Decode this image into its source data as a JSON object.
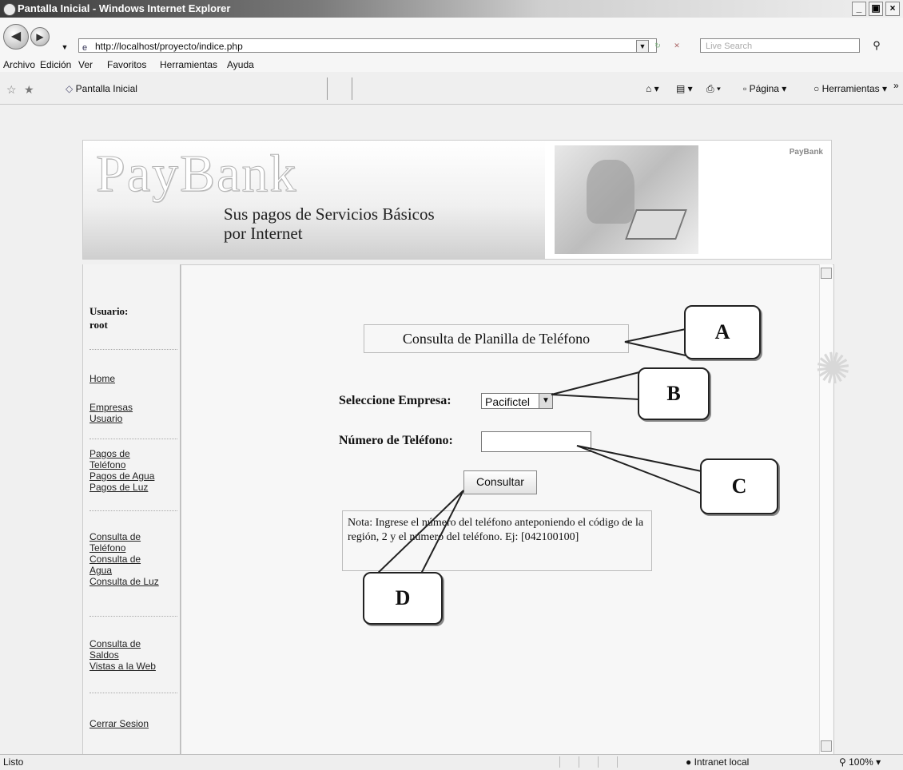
{
  "window": {
    "title": "Pantalla Inicial - Windows Internet Explorer",
    "controls": [
      "_",
      "×"
    ]
  },
  "address_bar": {
    "url": "http://localhost/proyecto/indice.php",
    "search_placeholder": "Live Search"
  },
  "menubar": [
    "Archivo",
    "Edición",
    "Ver",
    "Favoritos",
    "Herramientas",
    "Ayuda"
  ],
  "favorites_bar": {
    "tab_title": "Pantalla Inicial",
    "page_menu": "Página",
    "tools_menu": "Herramientas"
  },
  "banner": {
    "logo": "PayBank",
    "tagline_line1": "Sus pagos de Servicios Básicos",
    "tagline_line2": "por Internet",
    "right_title": "PayBank"
  },
  "sidebar": {
    "user_label": "Usuario:",
    "user_name": "root",
    "links": {
      "home": "Home",
      "empresas": "Empresas",
      "usuario": "Usuario",
      "pagos_telefono": "Pagos de Teléfono",
      "pagos_agua": "Pagos de Agua",
      "pagos_luz": "Pagos de Luz",
      "consulta_telefono": "Consulta de Teléfono",
      "consulta_agua": "Consulta de Agua",
      "consulta_luz": "Consulta de Luz",
      "consulta_saldos": "Consulta de Saldos",
      "vistas_web": "Vistas a la Web",
      "cerrar_sesion": "Cerrar Sesion"
    }
  },
  "form": {
    "title": "Consulta de Planilla de Teléfono",
    "empresa_label": "Seleccione Empresa:",
    "empresa_value": "Pacifictel",
    "telefono_label": "Número de Teléfono:",
    "telefono_value": "",
    "submit_label": "Consultar",
    "note": "Nota: Ingrese el número del teléfono anteponiendo el código de la región, 2 y el número del teléfono. Ej: [042100100]"
  },
  "callouts": [
    "A",
    "B",
    "C",
    "D"
  ],
  "statusbar": {
    "status": "Listo",
    "zone": "Intranet local",
    "zoom": "100%"
  }
}
